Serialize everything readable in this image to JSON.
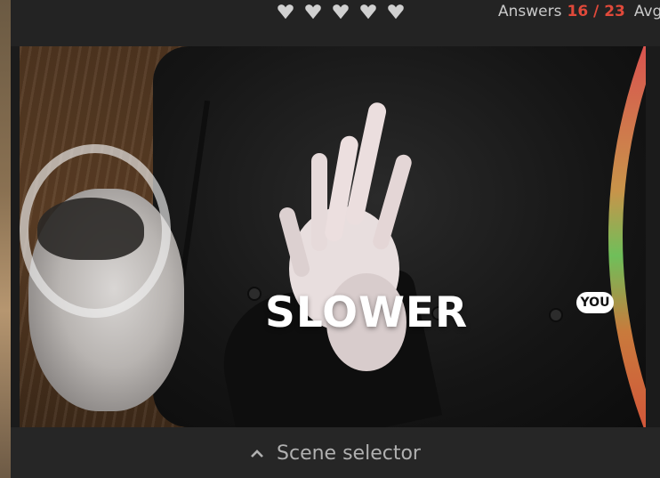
{
  "header": {
    "hearts": [
      "heart-icon",
      "heart-icon",
      "heart-icon",
      "heart-icon",
      "heart-icon"
    ],
    "answers_label": "Answers",
    "answers_count": "16 / 23",
    "avg_label": "Avg"
  },
  "scene": {
    "feedback_text": "SLOWER",
    "meter_badge": "YOU",
    "meter_level": 0.42
  },
  "footer": {
    "selector_label": "Scene selector",
    "selector_icon": "chevron-up-icon"
  },
  "colors": {
    "accent_red": "#e0493a",
    "meter_top": "#d9534f",
    "meter_mid": "#6fbf5a",
    "meter_bottom": "#d2573a"
  }
}
